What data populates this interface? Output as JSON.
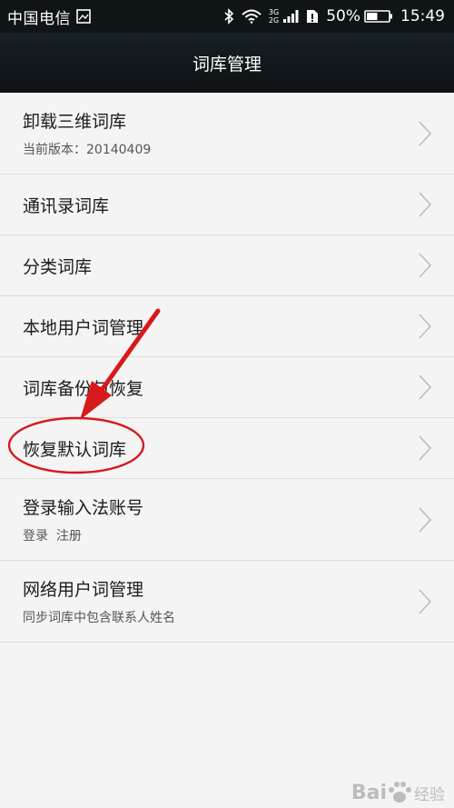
{
  "status_bar": {
    "carrier": "中国电信",
    "network_top": "3G",
    "network_bottom": "2G",
    "battery": "50%",
    "time": "15:49"
  },
  "header": {
    "title": "词库管理"
  },
  "items": [
    {
      "label": "卸载三维词库",
      "sub": "当前版本：20140409"
    },
    {
      "label": "通讯录词库"
    },
    {
      "label": "分类词库"
    },
    {
      "label": "本地用户词管理"
    },
    {
      "label": "词库备份与恢复"
    },
    {
      "label": "恢复默认词库"
    },
    {
      "label": "登录输入法账号",
      "sub": "登录  注册"
    },
    {
      "label": "网络用户词管理",
      "sub": "同步词库中包含联系人姓名"
    }
  ],
  "watermark": {
    "text": "Bai",
    "suffix": "经验"
  },
  "colors": {
    "annotation": "#d7191c",
    "header_bg": "#111719",
    "chevron": "#bdbdbd"
  },
  "battery_level": 0.5
}
